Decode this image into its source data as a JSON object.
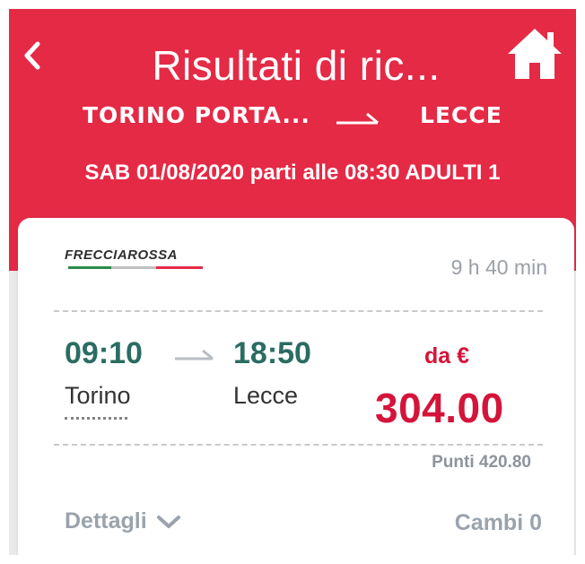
{
  "header": {
    "title": "Risultati di ric...",
    "route": {
      "from": "TORINO PORTA...",
      "to": "LECCE"
    },
    "search_summary": "SAB 01/08/2020 parti alle 08:30 ADULTI 1"
  },
  "solution": {
    "train_brand": "FRECCIAROSSA",
    "duration": "9 h 40 min",
    "departure_time": "09:10",
    "arrival_time": "18:50",
    "departure_station": "Torino",
    "arrival_station": "Lecce",
    "price_prefix": "da €",
    "price": "304.00",
    "points": "Punti 420.80",
    "details_label": "Dettagli",
    "changes": "Cambi 0"
  },
  "icons": {
    "back": "chevron-left-icon",
    "home": "home-icon",
    "route_arrow": "arrow-right-icon",
    "time_arrow": "arrow-right-icon",
    "details_toggle": "chevron-down-icon"
  },
  "colors": {
    "header_bg": "#e52a46",
    "time_color": "#2a6c61",
    "price_color": "#d4143a",
    "muted_text": "#9aa3ad"
  }
}
